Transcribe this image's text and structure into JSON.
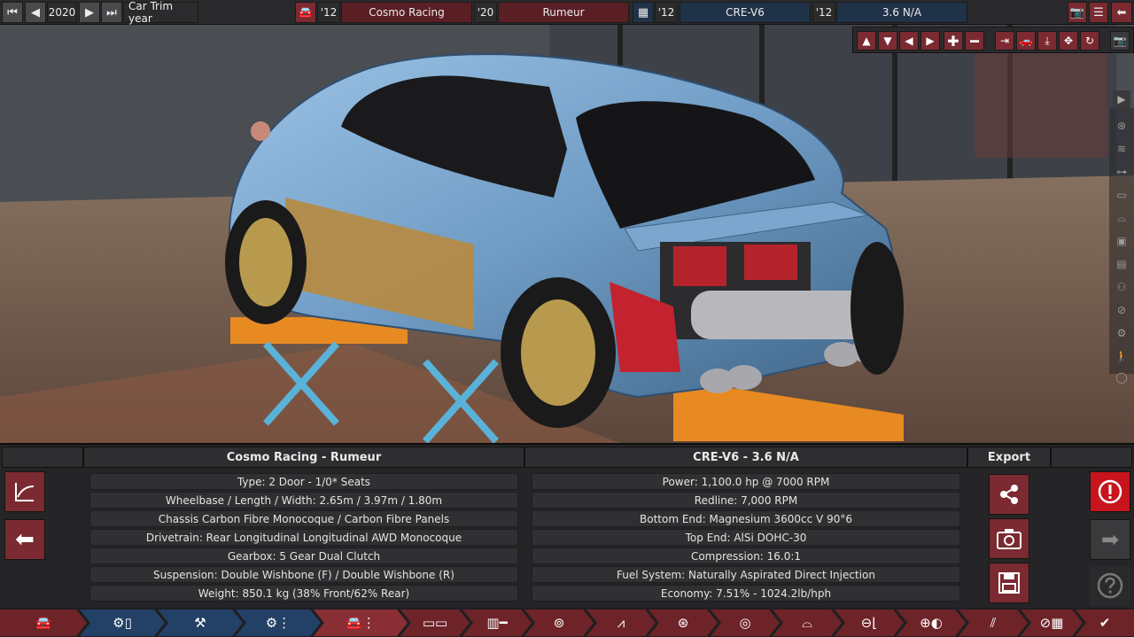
{
  "top_bar": {
    "year": "2020",
    "trim_year_label": "Car Trim year",
    "model_year": "'12",
    "brand": "Cosmo Racing",
    "trim_year": "'20",
    "model": "Rumeur",
    "engine_family_year": "'12",
    "engine_family": "CRE-V6",
    "engine_variant_year": "'12",
    "engine_variant": "3.6 N/A"
  },
  "car_panel": {
    "title": "Cosmo Racing - Rumeur",
    "rows": [
      "Type: 2 Door - 1/0* Seats",
      "Wheelbase / Length / Width: 2.65m / 3.97m / 1.80m",
      "Chassis Carbon Fibre Monocoque / Carbon Fibre Panels",
      "Drivetrain: Rear Longitudinal Longitudinal AWD Monocoque",
      "Gearbox: 5 Gear Dual Clutch",
      "Suspension: Double Wishbone (F) / Double Wishbone (R)",
      "Weight: 850.1 kg (38% Front/62% Rear)"
    ]
  },
  "engine_panel": {
    "title": "CRE-V6 - 3.6 N/A",
    "rows": [
      "Power: 1,100.0 hp @ 7000 RPM",
      "Redline:  7,000 RPM",
      "Bottom End: Magnesium 3600cc V 90°6",
      "Top End: AlSi DOHC-30",
      "Compression: 16.0:1",
      "Fuel System: Naturally Aspirated Direct Injection",
      "Economy: 7.51% - 1024.2lb/hph"
    ]
  },
  "export": {
    "title": "Export"
  },
  "colors": {
    "maroon": "#6e2329",
    "navy": "#234066",
    "alert": "#c8141c"
  }
}
